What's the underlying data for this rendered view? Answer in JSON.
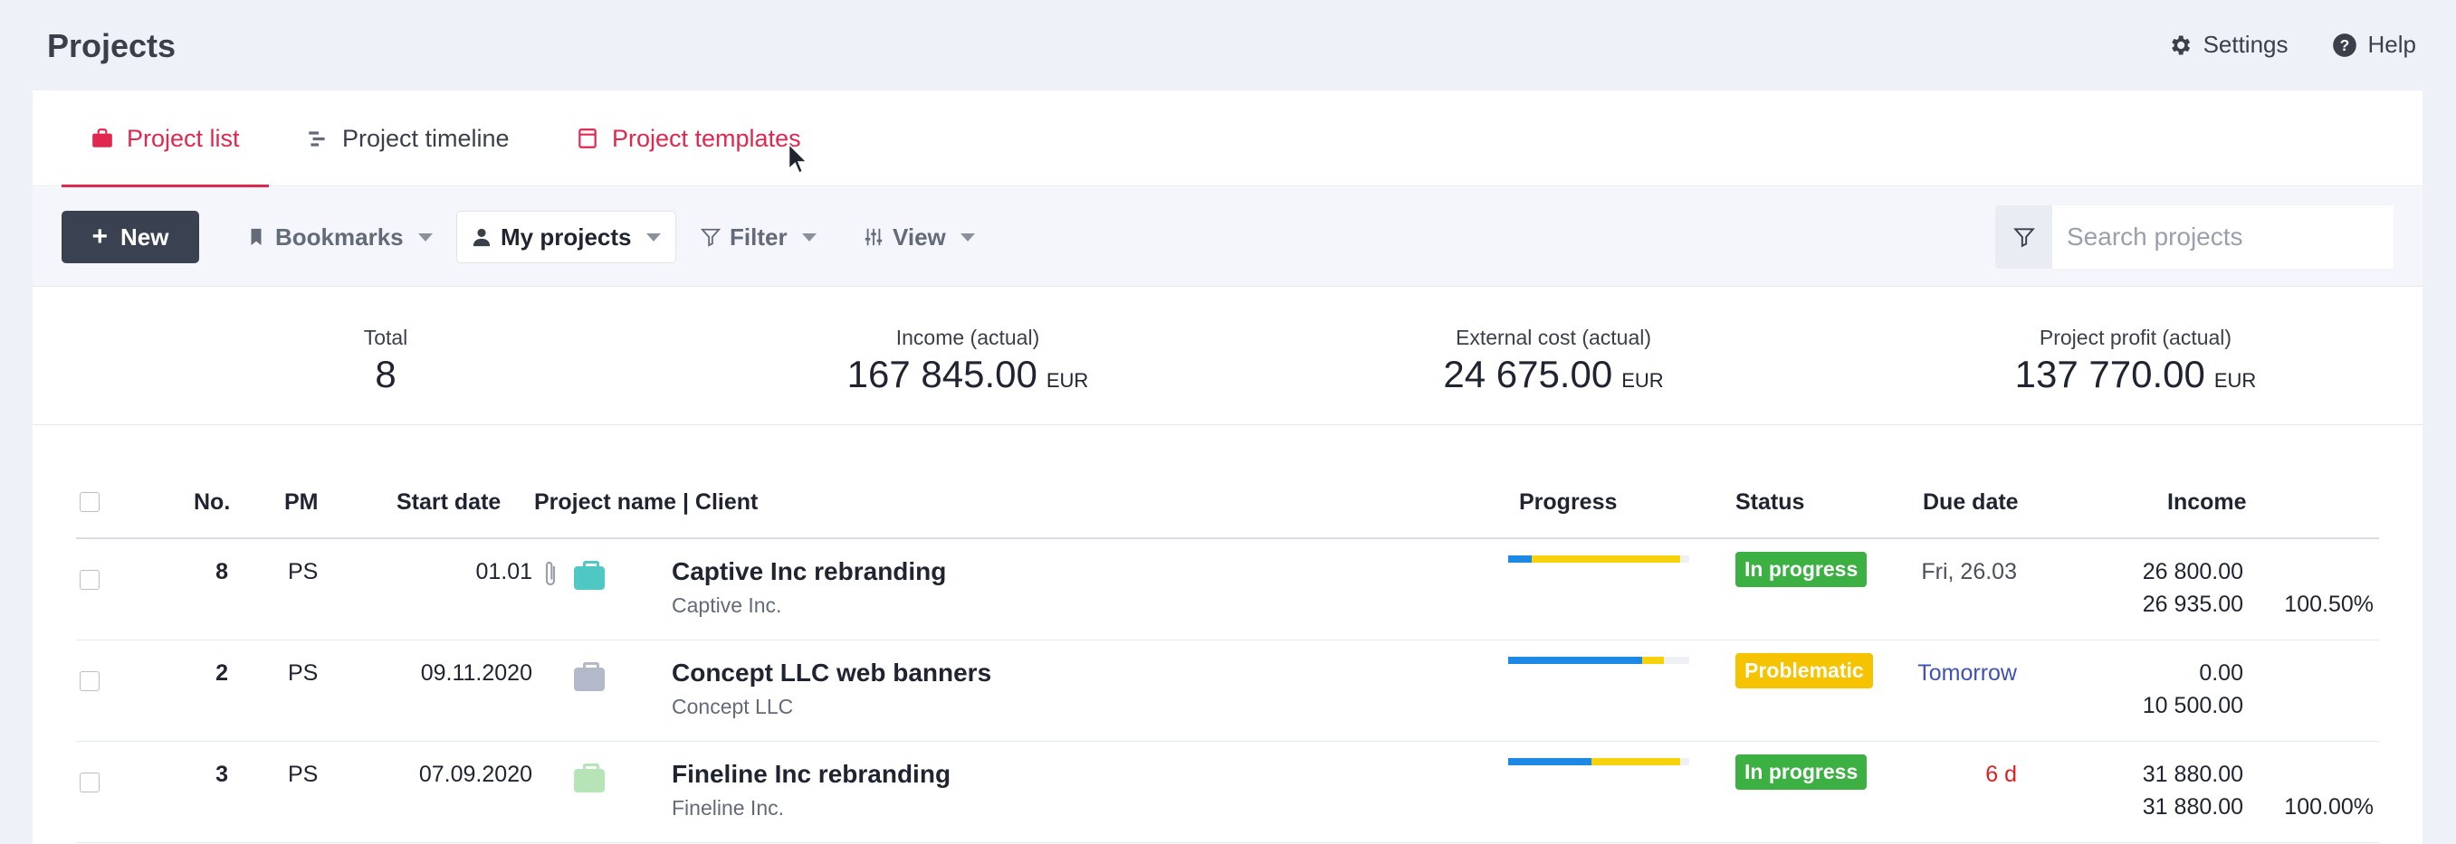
{
  "header": {
    "title": "Projects",
    "settings_label": "Settings",
    "help_label": "Help"
  },
  "tabs": [
    {
      "label": "Project list"
    },
    {
      "label": "Project timeline"
    },
    {
      "label": "Project templates"
    }
  ],
  "toolbar": {
    "new_label": "New",
    "bookmarks_label": "Bookmarks",
    "my_projects_label": "My projects",
    "filter_label": "Filter",
    "view_label": "View",
    "search_placeholder": "Search projects"
  },
  "summary": {
    "total_label": "Total",
    "total_value": "8",
    "income_label": "Income (actual)",
    "income_value": "167 845.00",
    "cost_label": "External cost (actual)",
    "cost_value": "24 675.00",
    "profit_label": "Project profit (actual)",
    "profit_value": "137 770.00",
    "currency": "EUR"
  },
  "table": {
    "columns": {
      "no": "No.",
      "pm": "PM",
      "start": "Start date",
      "name": "Project name | Client",
      "progress": "Progress",
      "status": "Status",
      "due": "Due date",
      "income": "Income"
    },
    "rows": [
      {
        "no": "8",
        "pm": "PS",
        "start": "01.01",
        "name": "Captive Inc rebranding",
        "client": "Captive Inc.",
        "bag_color": "#4fc7c3",
        "has_attachment": true,
        "progress_blue": 0.13,
        "progress_yellow": 0.82,
        "status": "In progress",
        "status_color": "#3cb043",
        "due": "Fri, 26.03",
        "due_color": "#4b505c",
        "income_top": "26 800.00",
        "income_bottom": "26 935.00",
        "income_pct": "100.50%"
      },
      {
        "no": "2",
        "pm": "PS",
        "start": "09.11.2020",
        "name": "Concept LLC web banners",
        "client": "Concept LLC",
        "bag_color": "#b3b9c8",
        "has_attachment": false,
        "progress_blue": 0.74,
        "progress_yellow": 0.12,
        "status": "Problematic",
        "status_color": "#f5c300",
        "due": "Tomorrow",
        "due_color": "#3f51b5",
        "income_top": "0.00",
        "income_bottom": "10 500.00",
        "income_pct": ""
      },
      {
        "no": "3",
        "pm": "PS",
        "start": "07.09.2020",
        "name": "Fineline Inc rebranding",
        "client": "Fineline Inc.",
        "bag_color": "#b7e4b7",
        "has_attachment": false,
        "progress_blue": 0.46,
        "progress_yellow": 0.49,
        "status": "In progress",
        "status_color": "#3cb043",
        "due": "6 d",
        "due_color": "#e02020",
        "income_top": "31 880.00",
        "income_bottom": "31 880.00",
        "income_pct": "100.00%"
      }
    ]
  }
}
